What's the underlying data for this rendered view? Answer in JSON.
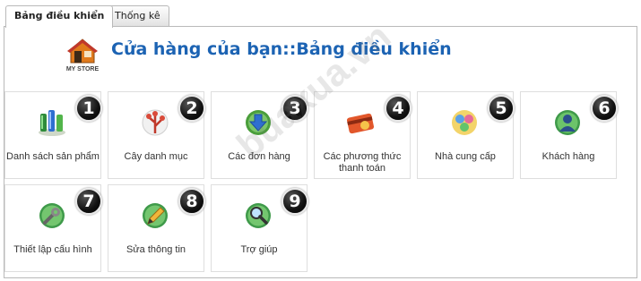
{
  "tabs": [
    {
      "label": "Bảng điều khiển",
      "active": true
    },
    {
      "label": "Thống kê",
      "active": false
    }
  ],
  "header": {
    "logo_text": "MY STORE",
    "title": "Cửa hàng của bạn::Bảng điều khiển"
  },
  "tiles": [
    {
      "number": "1",
      "label": "Danh sách sản phẩm",
      "icon": "products-icon"
    },
    {
      "number": "2",
      "label": "Cây danh mục",
      "icon": "category-tree-icon"
    },
    {
      "number": "3",
      "label": "Các đơn hàng",
      "icon": "orders-icon"
    },
    {
      "number": "4",
      "label": "Các phương thức thanh toán",
      "icon": "payment-methods-icon"
    },
    {
      "number": "5",
      "label": "Nhà cung cấp",
      "icon": "suppliers-icon"
    },
    {
      "number": "6",
      "label": "Khách hàng",
      "icon": "customers-icon"
    },
    {
      "number": "7",
      "label": "Thiết lập cấu hình",
      "icon": "configuration-icon"
    },
    {
      "number": "8",
      "label": "Sửa thông tin",
      "icon": "edit-info-icon"
    },
    {
      "number": "9",
      "label": "Trợ giúp",
      "icon": "help-icon"
    }
  ],
  "watermark": "buaxua.vn",
  "colors": {
    "title": "#1c63b3",
    "tile_border": "#dedede",
    "panel_border": "#b9b9b9"
  }
}
